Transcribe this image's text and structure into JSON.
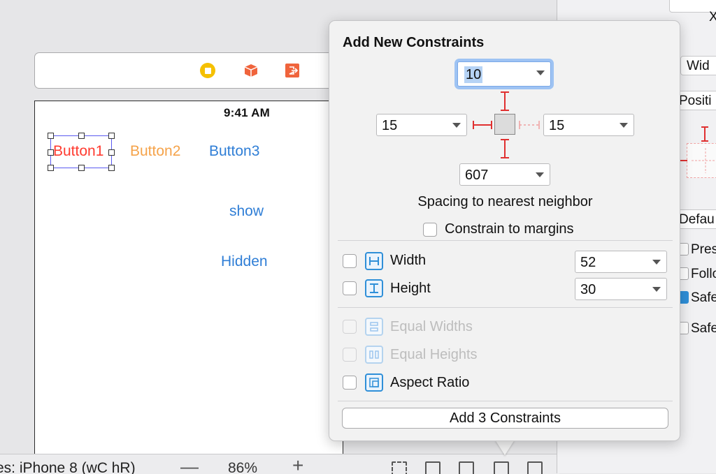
{
  "canvas": {
    "status_time": "9:41 AM",
    "buttons": {
      "button1": "Button1",
      "button2": "Button2",
      "button3": "Button3",
      "show": "show",
      "hidden": "Hidden"
    }
  },
  "bottom_bar": {
    "device_label": "es: iPhone 8 (wC hR)",
    "zoom_out": "—",
    "zoom_level": "86%",
    "zoom_in": "+"
  },
  "inspector": {
    "x_label": "X",
    "width_partial": "Wid",
    "position_partial": "Positi",
    "default_partial": "Defau",
    "preserve_partial": "Pres",
    "follow_partial": "Follo",
    "safe1_partial": "Safe",
    "safe2_partial": "Safe"
  },
  "popover": {
    "title": "Add New Constraints",
    "top_value": "10",
    "left_value": "15",
    "right_value": "15",
    "bottom_value": "607",
    "spacing_label": "Spacing to nearest neighbor",
    "constrain_margins": "Constrain to margins",
    "width_label": "Width",
    "width_value": "52",
    "height_label": "Height",
    "height_value": "30",
    "equal_widths": "Equal Widths",
    "equal_heights": "Equal Heights",
    "aspect_ratio": "Aspect Ratio",
    "add_button": "Add 3 Constraints"
  },
  "colors": {
    "accent": "#2f8fd8",
    "constraint_red": "#e03030",
    "button_red": "#ff3b30",
    "button_orange": "#f5a34a",
    "button_blue": "#2f7ed6"
  }
}
